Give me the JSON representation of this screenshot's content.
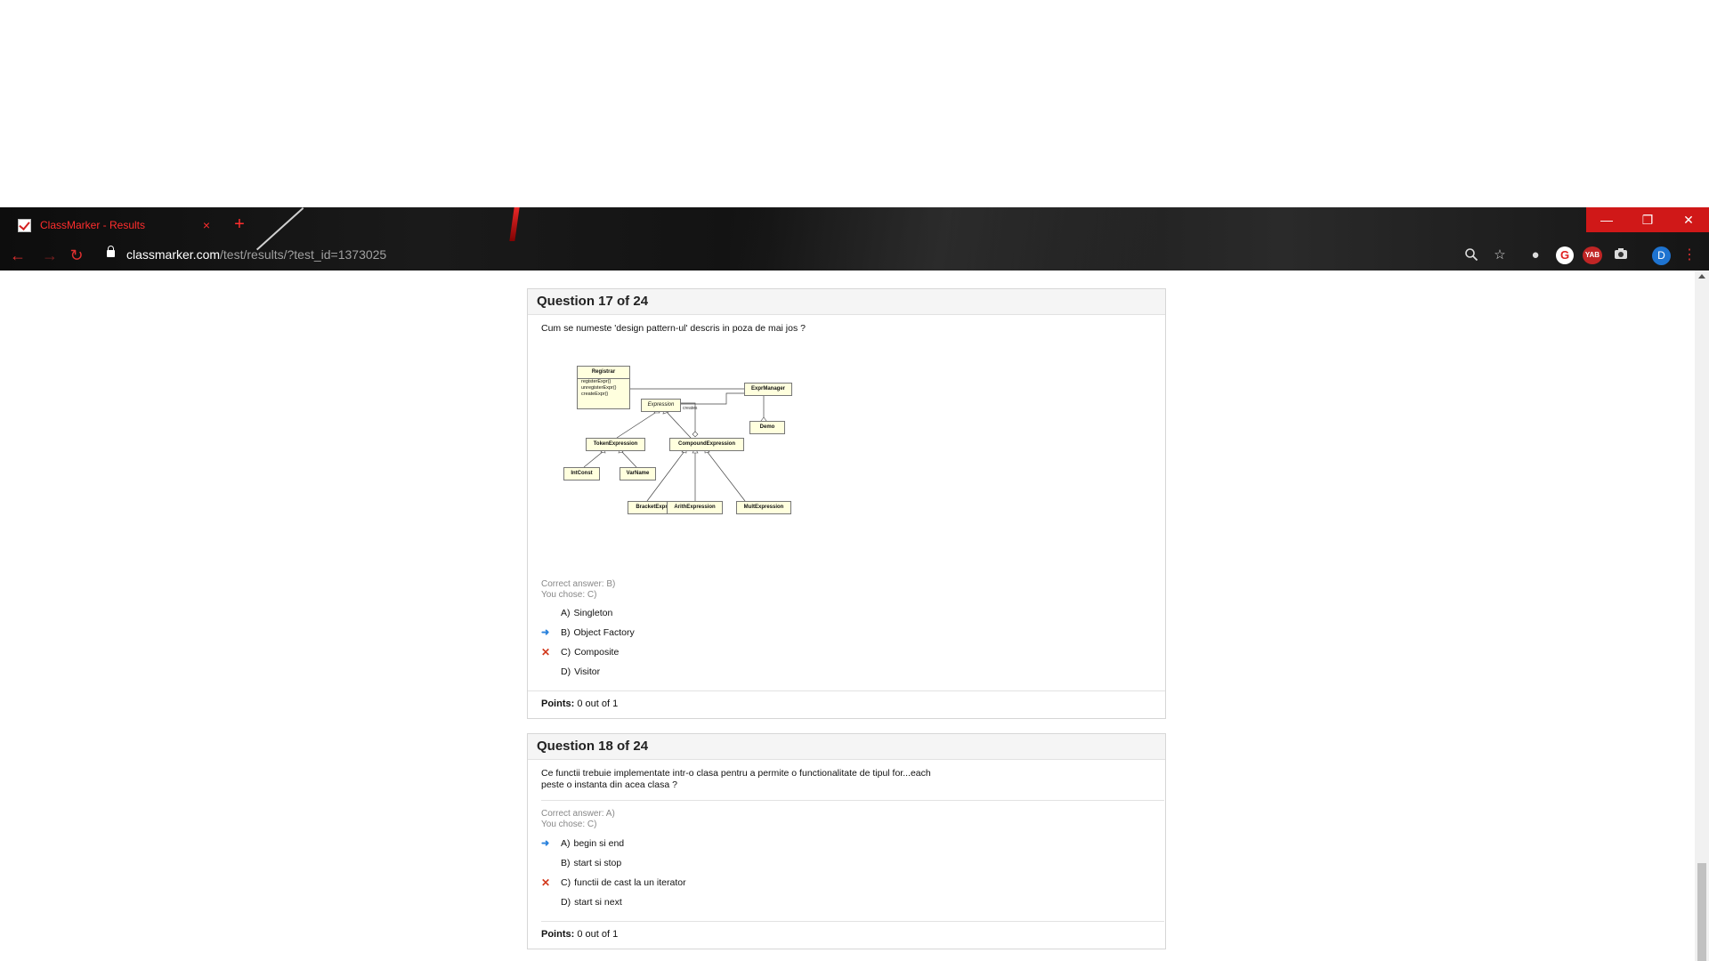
{
  "browser": {
    "tab_title": "ClassMarker - Results",
    "tab_close": "×",
    "new_tab": "+",
    "url_host": "classmarker.com",
    "url_path": "/test/results/?test_id=1373025",
    "avatar_letter": "D",
    "extension_g": "G",
    "extension_yab": "YAB",
    "window_min": "—",
    "window_max": "❐",
    "window_close": "✕",
    "icons": [
      "back-icon",
      "forward-icon",
      "reload-icon",
      "lock-icon",
      "zoom-icon",
      "star-icon",
      "extension-icon",
      "camera-icon",
      "menu-icon"
    ]
  },
  "questions": [
    {
      "header": "Question 17 of 24",
      "text": "Cum se numeste 'design pattern-ul' descris in poza de mai jos ?",
      "correct_answer": "Correct answer: B)",
      "you_chose": "You chose: C)",
      "options": [
        {
          "letter": "A)",
          "text": "Singleton",
          "mark": ""
        },
        {
          "letter": "B)",
          "text": "Object Factory",
          "mark": "arrow"
        },
        {
          "letter": "C)",
          "text": "Composite",
          "mark": "x"
        },
        {
          "letter": "D)",
          "text": "Visitor",
          "mark": ""
        }
      ],
      "points_label": "Points:",
      "points_value": "0 out of 1",
      "diagram": {
        "registrar": "Registrar",
        "registrar_ops": [
          "registerExpr()",
          "unregisterExpr()",
          "createExpr()"
        ],
        "expr_manager": "ExprManager",
        "expression": "Expression",
        "creates": "creates",
        "demo": "Demo",
        "token_expression": "TokenExpression",
        "compound_expression": "CompoundExpression",
        "int_const": "IntConst",
        "var_name": "VarName",
        "bracket_expression": "BracketExpression",
        "arith_expression": "ArithExpression",
        "mult_expression": "MultExpression"
      }
    },
    {
      "header": "Question 18 of 24",
      "text_line1": "Ce functii trebuie implementate intr-o clasa pentru a permite o functionalitate de tipul for...each",
      "text_line2": "peste o instanta din acea clasa ?",
      "correct_answer": "Correct answer: A)",
      "you_chose": "You chose: C)",
      "options": [
        {
          "letter": "A)",
          "text": "begin si end",
          "mark": "arrow"
        },
        {
          "letter": "B)",
          "text": "start si stop",
          "mark": ""
        },
        {
          "letter": "C)",
          "text": "functii de cast la un iterator",
          "mark": "x"
        },
        {
          "letter": "D)",
          "text": "start si next",
          "mark": ""
        }
      ],
      "points_label": "Points:",
      "points_value": "0 out of 1"
    }
  ],
  "colors": {
    "accent_red": "#ff2d2d",
    "window_red": "#d01818",
    "arrow_blue": "#2a82dc",
    "wrong_red": "#d23a1e"
  }
}
